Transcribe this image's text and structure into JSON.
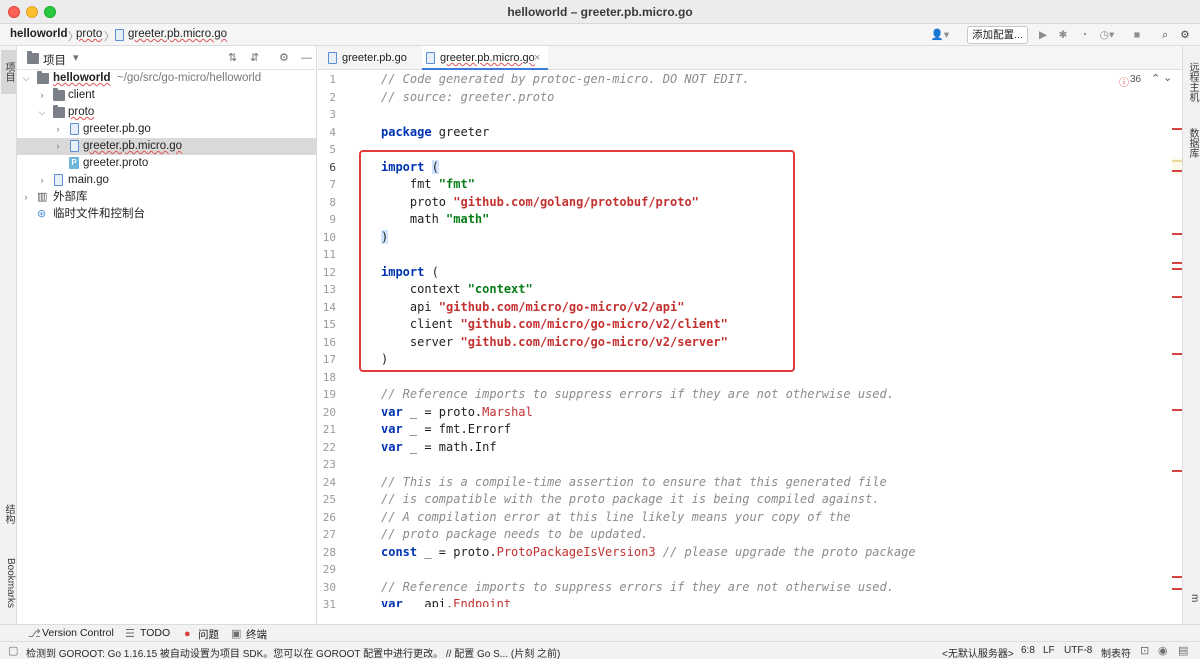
{
  "window": {
    "title": "helloworld – greeter.pb.micro.go"
  },
  "breadcrumb": {
    "project": "helloworld",
    "folder": "proto",
    "file": "greeter.pb.micro.go"
  },
  "toolbar": {
    "add_config": "添加配置..."
  },
  "left_tabs": {
    "project": "项目",
    "structure": "结构",
    "bookmarks": "Bookmarks"
  },
  "right_tabs": {
    "remote_host": "远程主机",
    "database": "数据库",
    "maven": "m"
  },
  "project_panel": {
    "title": "项目",
    "root": "helloworld",
    "root_path": "~/go/src/go-micro/helloworld",
    "items": [
      {
        "label": "client"
      },
      {
        "label": "proto"
      },
      {
        "label": "greeter.pb.go"
      },
      {
        "label": "greeter.pb.micro.go"
      },
      {
        "label": "greeter.proto"
      },
      {
        "label": "main.go"
      },
      {
        "label": "外部库"
      },
      {
        "label": "临时文件和控制台"
      }
    ]
  },
  "editor": {
    "tabs": [
      "greeter.pb.go",
      "greeter.pb.micro.go"
    ],
    "warnings_count": "36",
    "line_numbers": [
      "1",
      "2",
      "3",
      "4",
      "5",
      "6",
      "7",
      "8",
      "9",
      "10",
      "11",
      "12",
      "13",
      "14",
      "15",
      "16",
      "17",
      "18",
      "19",
      "20",
      "21",
      "22",
      "23",
      "24",
      "25",
      "26",
      "27",
      "28",
      "29",
      "30",
      "31"
    ],
    "lines": {
      "l1": "// Code generated by protoc-gen-micro. DO NOT EDIT.",
      "l2": "// source: greeter.proto",
      "l4_kw": "package",
      "l4_rest": " greeter",
      "l6_kw": "import",
      "l6_paren": "(",
      "l7_a": "    fmt ",
      "l7_s": "\"fmt\"",
      "l8_a": "    proto ",
      "l8_s": "\"github.com/golang/protobuf/proto\"",
      "l9_a": "    math ",
      "l9_s": "\"math\"",
      "l10_paren": ")",
      "l12_kw": "import",
      "l12_rest": " (",
      "l13_a": "    context ",
      "l13_s": "\"context\"",
      "l14_a": "    api ",
      "l14_s": "\"github.com/micro/go-micro/v2/api\"",
      "l15_a": "    client ",
      "l15_s": "\"github.com/micro/go-micro/v2/client\"",
      "l16_a": "    server ",
      "l16_s": "\"github.com/micro/go-micro/v2/server\"",
      "l17": ")",
      "l19": "// Reference imports to suppress errors if they are not otherwise used.",
      "l20_kw": "var",
      "l20_a": " _ = proto.",
      "l20_f": "Marshal",
      "l21_kw": "var",
      "l21_a": " _ = fmt.Errorf",
      "l22_kw": "var",
      "l22_a": " _ = math.Inf",
      "l24": "// This is a compile-time assertion to ensure that this generated file",
      "l25": "// is compatible with the proto package it is being compiled against.",
      "l26": "// A compilation error at this line likely means your copy of the",
      "l27": "// proto package needs to be updated.",
      "l28_kw": "const",
      "l28_a": " _ = proto.",
      "l28_f": "ProtoPackageIsVersion3",
      "l28_c": " // please upgrade the proto package",
      "l30": "// Reference imports to suppress errors if they are not otherwise used.",
      "l31_kw": "var",
      "l31_a": " _ api.",
      "l31_f": "Endpoint"
    }
  },
  "tool_windows": {
    "version_control": "Version Control",
    "todo": "TODO",
    "problems": "问题",
    "terminal": "终端"
  },
  "status": {
    "message": "检测到 GOROOT: Go 1.16.15 被自动设置为项目 SDK。您可以在 GOROOT 配置中进行更改。 // 配置 Go S... (片刻 之前)",
    "server": "<无默认服务器>",
    "position": "6:8",
    "line_sep": "LF",
    "encoding": "UTF-8",
    "indent": "制表符"
  },
  "colors": {
    "keyword": "#0033b3",
    "string": "#067d17",
    "highlight_box": "#e03c3c",
    "accent": "#3d7bd9"
  }
}
